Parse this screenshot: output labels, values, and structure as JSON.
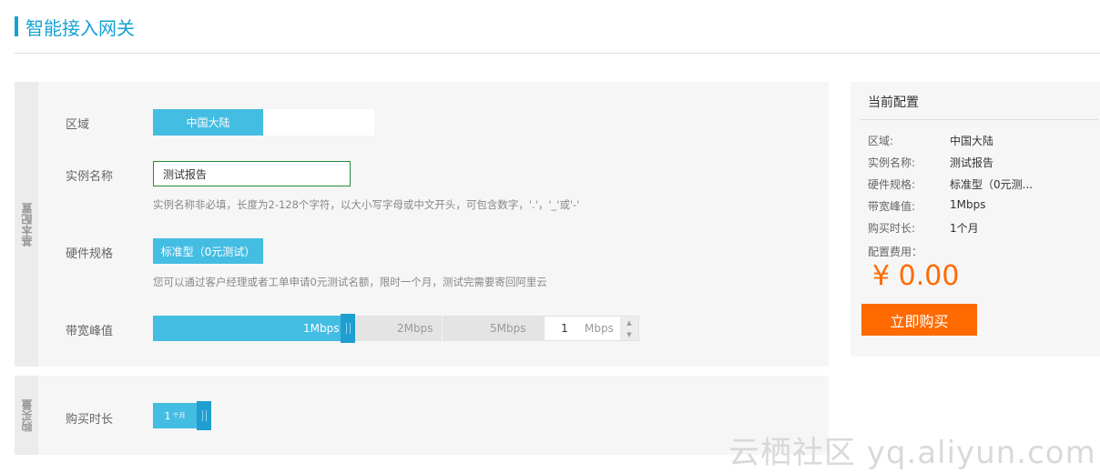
{
  "page_title": "智能接入网关",
  "sections": {
    "basic": {
      "side_label": "基本配置"
    },
    "purchase": {
      "side_label": "购买量"
    }
  },
  "region": {
    "label": "区域",
    "selected": "中国大陆"
  },
  "instance_name": {
    "label": "实例名称",
    "value": "测试报告",
    "hint": "实例名称非必填，长度为2-128个字符，以大小写字母或中文开头，可包含数字，'.'，'_'或'-'"
  },
  "hardware": {
    "label": "硬件规格",
    "selected": "标准型（0元测试）",
    "hint": "您可以通过客户经理或者工单申请0元测试名额，限时一个月，测试完需要寄回阿里云"
  },
  "bandwidth": {
    "label": "带宽峰值",
    "ticks": [
      "1Mbps",
      "2Mbps",
      "5Mbps"
    ],
    "input_value": "1",
    "unit": "Mbps",
    "selected_index": 0
  },
  "duration": {
    "label": "购买时长",
    "value": "1",
    "unit": "个月"
  },
  "summary": {
    "title": "当前配置",
    "rows": [
      {
        "key": "区域:",
        "value": "中国大陆"
      },
      {
        "key": "实例名称:",
        "value": "测试报告"
      },
      {
        "key": "硬件规格:",
        "value": "标准型（0元测..."
      },
      {
        "key": "带宽峰值:",
        "value": "1Mbps"
      },
      {
        "key": "购买时长:",
        "value": "1个月"
      }
    ],
    "fee_label": "配置费用：",
    "price": "¥ 0.00",
    "buy_label": "立即购买"
  },
  "watermark": "云栖社区 yq.aliyun.com",
  "colors": {
    "accent": "#14a2d4",
    "slider": "#44bde3",
    "price": "#ff6a00"
  }
}
